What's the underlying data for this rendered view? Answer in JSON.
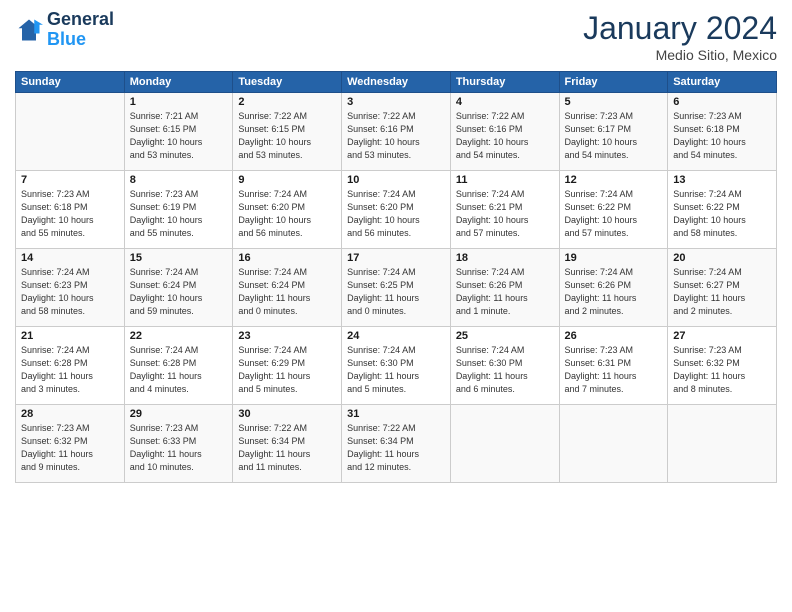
{
  "logo": {
    "line1": "General",
    "line2": "Blue"
  },
  "title": "January 2024",
  "subtitle": "Medio Sitio, Mexico",
  "header_days": [
    "Sunday",
    "Monday",
    "Tuesday",
    "Wednesday",
    "Thursday",
    "Friday",
    "Saturday"
  ],
  "weeks": [
    [
      {
        "num": "",
        "info": ""
      },
      {
        "num": "1",
        "info": "Sunrise: 7:21 AM\nSunset: 6:15 PM\nDaylight: 10 hours\nand 53 minutes."
      },
      {
        "num": "2",
        "info": "Sunrise: 7:22 AM\nSunset: 6:15 PM\nDaylight: 10 hours\nand 53 minutes."
      },
      {
        "num": "3",
        "info": "Sunrise: 7:22 AM\nSunset: 6:16 PM\nDaylight: 10 hours\nand 53 minutes."
      },
      {
        "num": "4",
        "info": "Sunrise: 7:22 AM\nSunset: 6:16 PM\nDaylight: 10 hours\nand 54 minutes."
      },
      {
        "num": "5",
        "info": "Sunrise: 7:23 AM\nSunset: 6:17 PM\nDaylight: 10 hours\nand 54 minutes."
      },
      {
        "num": "6",
        "info": "Sunrise: 7:23 AM\nSunset: 6:18 PM\nDaylight: 10 hours\nand 54 minutes."
      }
    ],
    [
      {
        "num": "7",
        "info": "Sunrise: 7:23 AM\nSunset: 6:18 PM\nDaylight: 10 hours\nand 55 minutes."
      },
      {
        "num": "8",
        "info": "Sunrise: 7:23 AM\nSunset: 6:19 PM\nDaylight: 10 hours\nand 55 minutes."
      },
      {
        "num": "9",
        "info": "Sunrise: 7:24 AM\nSunset: 6:20 PM\nDaylight: 10 hours\nand 56 minutes."
      },
      {
        "num": "10",
        "info": "Sunrise: 7:24 AM\nSunset: 6:20 PM\nDaylight: 10 hours\nand 56 minutes."
      },
      {
        "num": "11",
        "info": "Sunrise: 7:24 AM\nSunset: 6:21 PM\nDaylight: 10 hours\nand 57 minutes."
      },
      {
        "num": "12",
        "info": "Sunrise: 7:24 AM\nSunset: 6:22 PM\nDaylight: 10 hours\nand 57 minutes."
      },
      {
        "num": "13",
        "info": "Sunrise: 7:24 AM\nSunset: 6:22 PM\nDaylight: 10 hours\nand 58 minutes."
      }
    ],
    [
      {
        "num": "14",
        "info": "Sunrise: 7:24 AM\nSunset: 6:23 PM\nDaylight: 10 hours\nand 58 minutes."
      },
      {
        "num": "15",
        "info": "Sunrise: 7:24 AM\nSunset: 6:24 PM\nDaylight: 10 hours\nand 59 minutes."
      },
      {
        "num": "16",
        "info": "Sunrise: 7:24 AM\nSunset: 6:24 PM\nDaylight: 11 hours\nand 0 minutes."
      },
      {
        "num": "17",
        "info": "Sunrise: 7:24 AM\nSunset: 6:25 PM\nDaylight: 11 hours\nand 0 minutes."
      },
      {
        "num": "18",
        "info": "Sunrise: 7:24 AM\nSunset: 6:26 PM\nDaylight: 11 hours\nand 1 minute."
      },
      {
        "num": "19",
        "info": "Sunrise: 7:24 AM\nSunset: 6:26 PM\nDaylight: 11 hours\nand 2 minutes."
      },
      {
        "num": "20",
        "info": "Sunrise: 7:24 AM\nSunset: 6:27 PM\nDaylight: 11 hours\nand 2 minutes."
      }
    ],
    [
      {
        "num": "21",
        "info": "Sunrise: 7:24 AM\nSunset: 6:28 PM\nDaylight: 11 hours\nand 3 minutes."
      },
      {
        "num": "22",
        "info": "Sunrise: 7:24 AM\nSunset: 6:28 PM\nDaylight: 11 hours\nand 4 minutes."
      },
      {
        "num": "23",
        "info": "Sunrise: 7:24 AM\nSunset: 6:29 PM\nDaylight: 11 hours\nand 5 minutes."
      },
      {
        "num": "24",
        "info": "Sunrise: 7:24 AM\nSunset: 6:30 PM\nDaylight: 11 hours\nand 5 minutes."
      },
      {
        "num": "25",
        "info": "Sunrise: 7:24 AM\nSunset: 6:30 PM\nDaylight: 11 hours\nand 6 minutes."
      },
      {
        "num": "26",
        "info": "Sunrise: 7:23 AM\nSunset: 6:31 PM\nDaylight: 11 hours\nand 7 minutes."
      },
      {
        "num": "27",
        "info": "Sunrise: 7:23 AM\nSunset: 6:32 PM\nDaylight: 11 hours\nand 8 minutes."
      }
    ],
    [
      {
        "num": "28",
        "info": "Sunrise: 7:23 AM\nSunset: 6:32 PM\nDaylight: 11 hours\nand 9 minutes."
      },
      {
        "num": "29",
        "info": "Sunrise: 7:23 AM\nSunset: 6:33 PM\nDaylight: 11 hours\nand 10 minutes."
      },
      {
        "num": "30",
        "info": "Sunrise: 7:22 AM\nSunset: 6:34 PM\nDaylight: 11 hours\nand 11 minutes."
      },
      {
        "num": "31",
        "info": "Sunrise: 7:22 AM\nSunset: 6:34 PM\nDaylight: 11 hours\nand 12 minutes."
      },
      {
        "num": "",
        "info": ""
      },
      {
        "num": "",
        "info": ""
      },
      {
        "num": "",
        "info": ""
      }
    ]
  ]
}
